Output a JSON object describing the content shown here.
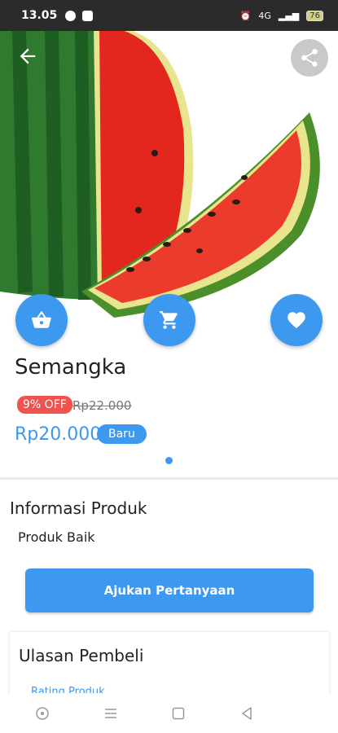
{
  "status_bar": {
    "time": "13.05",
    "network": "4G",
    "battery": "76"
  },
  "product": {
    "name": "Semangka",
    "discount_badge": "9% OFF",
    "original_price": "Rp22.000",
    "price": "Rp20.000",
    "condition_badge": "Baru"
  },
  "info": {
    "title": "Informasi Produk",
    "description": "Produk Baik"
  },
  "ask_button": "Ajukan Pertanyaan",
  "reviews": {
    "title": "Ulasan Pembeli",
    "rating_link": "Rating Produk"
  },
  "colors": {
    "accent": "#3d99ef",
    "discount": "#f0534f"
  },
  "icons": {
    "back": "back-arrow-icon",
    "share": "share-icon",
    "basket": "basket-icon",
    "cart": "cart-icon",
    "favorite": "heart-icon"
  }
}
